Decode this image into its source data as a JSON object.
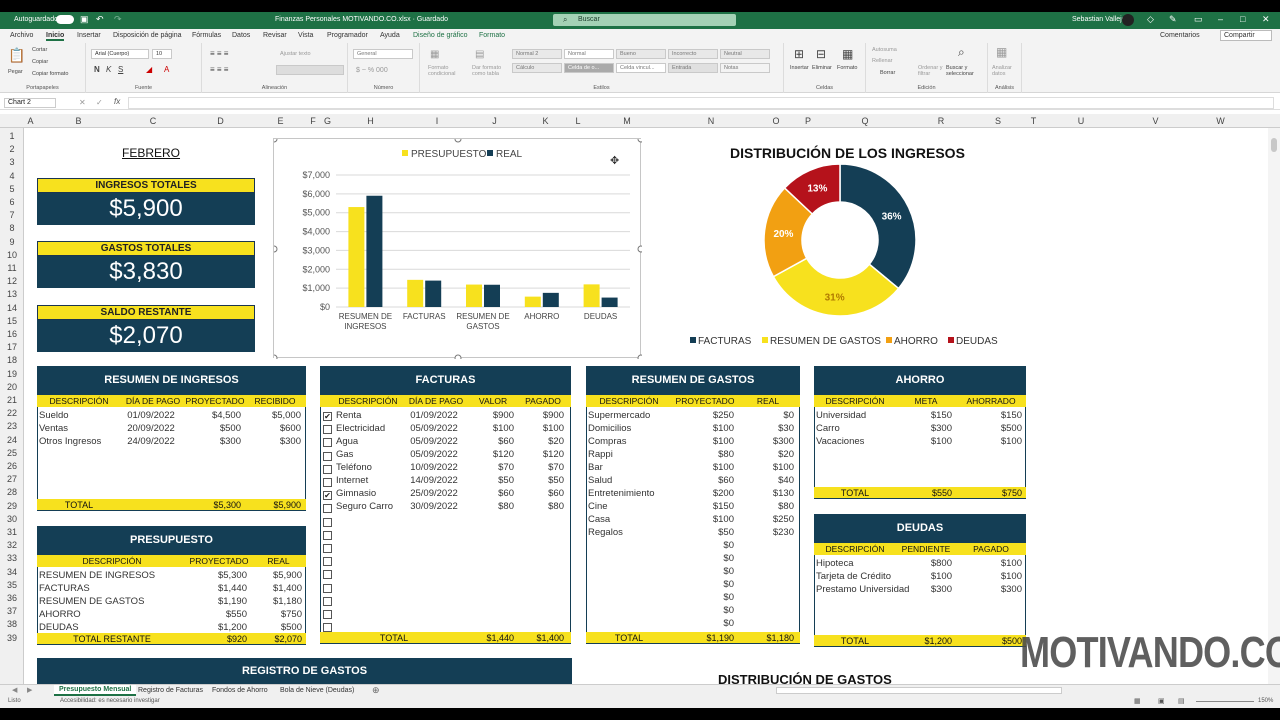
{
  "window": {
    "autosave_label": "Autoguardado",
    "doc_title": "Finanzas Personales MOTIVANDO.CO.xlsx · Guardado",
    "search_placeholder": "Buscar",
    "user_name": "Sebastian Vallejo",
    "accent": "#1e7145"
  },
  "ribbon": {
    "tabs": [
      "Archivo",
      "Inicio",
      "Insertar",
      "Disposición de página",
      "Fórmulas",
      "Datos",
      "Revisar",
      "Vista",
      "Programador",
      "Ayuda",
      "Diseño de gráfico",
      "Formato"
    ],
    "active_tab": "Inicio",
    "comments": "Comentarios",
    "share": "Compartir",
    "clipboard": {
      "paste": "Pegar",
      "cut": "Cortar",
      "copy": "Copiar",
      "format": "Copiar formato",
      "label": "Portapapeles"
    },
    "font": {
      "name": "Arial (Cuerpo)",
      "size": "10",
      "label": "Fuente"
    },
    "alignment": {
      "wrap": "Ajustar texto",
      "label": "Alineación"
    },
    "number": {
      "format": "General",
      "label": "Número"
    },
    "styles": {
      "cond": "Formato condicional",
      "table": "Dar formato como tabla",
      "cells": [
        "Normal 2",
        "Normal",
        "Bueno",
        "Incorrecto",
        "Neutral",
        "Cálculo",
        "Celda de o...",
        "Celda vincul...",
        "Entrada",
        "Notas"
      ],
      "label": "Estilos"
    },
    "cells_grp": {
      "insert": "Insertar",
      "delete": "Eliminar",
      "format": "Formato",
      "label": "Celdas"
    },
    "editing": {
      "autosum": "Autosuma",
      "fill": "Rellenar",
      "clear": "Borrar",
      "sort": "Ordenar y filtrar",
      "find": "Buscar y seleccionar",
      "label": "Edición"
    },
    "analysis": {
      "analyze": "Analizar datos",
      "label": "Análisis"
    }
  },
  "formula_bar": {
    "name_box": "Chart 2",
    "fx": "fx"
  },
  "columns": [
    "A",
    "B",
    "C",
    "D",
    "E",
    "F",
    "G",
    "H",
    "I",
    "J",
    "K",
    "L",
    "M",
    "N",
    "O",
    "P",
    "Q",
    "R",
    "S",
    "T",
    "U",
    "V",
    "W"
  ],
  "rows": [
    "1",
    "2",
    "3",
    "4",
    "5",
    "6",
    "7",
    "8",
    "9",
    "10",
    "11",
    "12",
    "13",
    "14",
    "15",
    "16",
    "17",
    "18",
    "19",
    "20",
    "21",
    "22",
    "23",
    "24",
    "25",
    "26",
    "27",
    "28",
    "29",
    "30",
    "31",
    "32",
    "33",
    "34",
    "35",
    "36",
    "37",
    "38",
    "39"
  ],
  "month": "FEBRERO",
  "kpis": [
    {
      "label": "INGRESOS TOTALES",
      "value": "$5,900"
    },
    {
      "label": "GASTOS TOTALES",
      "value": "$3,830"
    },
    {
      "label": "SALDO RESTANTE",
      "value": "$2,070"
    }
  ],
  "colors": {
    "navy": "#143e55",
    "yellow": "#f7e11e",
    "orange": "#f2a012",
    "red": "#b5121b"
  },
  "chart_data": [
    {
      "type": "bar",
      "categories": [
        "RESUMEN DE INGRESOS",
        "FACTURAS",
        "RESUMEN DE GASTOS",
        "AHORRO",
        "DEUDAS"
      ],
      "series": [
        {
          "name": "PRESUPUESTO",
          "values": [
            5300,
            1440,
            1190,
            550,
            1200
          ],
          "color": "#f7e11e"
        },
        {
          "name": "REAL",
          "values": [
            5900,
            1400,
            1180,
            750,
            500
          ],
          "color": "#143e55"
        }
      ],
      "yticks": [
        "$0",
        "$1,000",
        "$2,000",
        "$3,000",
        "$4,000",
        "$5,000",
        "$6,000",
        "$7,000"
      ],
      "ylim": [
        0,
        7000
      ],
      "grid": true,
      "legend": "top"
    },
    {
      "type": "pie",
      "title": "DISTRIBUCIÓN DE LOS INGRESOS",
      "categories": [
        "FACTURAS",
        "RESUMEN DE GASTOS",
        "AHORRO",
        "DEUDAS"
      ],
      "values": [
        36,
        31,
        20,
        13
      ],
      "labels": [
        "36%",
        "31%",
        "20%",
        "13%"
      ],
      "colors": [
        "#143e55",
        "#f7e11e",
        "#f2a012",
        "#b5121b"
      ],
      "donut": true,
      "legend": "bottom"
    }
  ],
  "ingresos": {
    "title": "RESUMEN DE INGRESOS",
    "headers": [
      "DESCRIPCIÓN",
      "DÍA DE PAGO",
      "PROYECTADO",
      "RECIBIDO"
    ],
    "rows": [
      [
        "Sueldo",
        "01/09/2022",
        "$4,500",
        "$5,000"
      ],
      [
        "Ventas",
        "20/09/2022",
        "$500",
        "$600"
      ],
      [
        "Otros Ingresos",
        "24/09/2022",
        "$300",
        "$300"
      ]
    ],
    "total": [
      "TOTAL",
      "$5,300",
      "$5,900"
    ]
  },
  "facturas": {
    "title": "FACTURAS",
    "headers": [
      "DESCRIPCIÓN",
      "DÍA DE PAGO",
      "VALOR",
      "PAGADO"
    ],
    "rows": [
      {
        "checked": true,
        "cells": [
          "Renta",
          "01/09/2022",
          "$900",
          "$900"
        ]
      },
      {
        "checked": false,
        "cells": [
          "Electricidad",
          "05/09/2022",
          "$100",
          "$100"
        ]
      },
      {
        "checked": false,
        "cells": [
          "Agua",
          "05/09/2022",
          "$60",
          "$20"
        ]
      },
      {
        "checked": false,
        "cells": [
          "Gas",
          "05/09/2022",
          "$120",
          "$120"
        ]
      },
      {
        "checked": false,
        "cells": [
          "Teléfono",
          "10/09/2022",
          "$70",
          "$70"
        ]
      },
      {
        "checked": false,
        "cells": [
          "Internet",
          "14/09/2022",
          "$50",
          "$50"
        ]
      },
      {
        "checked": true,
        "cells": [
          "Gimnasio",
          "25/09/2022",
          "$60",
          "$60"
        ]
      },
      {
        "checked": false,
        "cells": [
          "Seguro Carro",
          "30/09/2022",
          "$80",
          "$80"
        ]
      }
    ],
    "empty_checkboxes": 9,
    "total": [
      "TOTAL",
      "$1,440",
      "$1,400"
    ]
  },
  "gastos": {
    "title": "RESUMEN DE GASTOS",
    "headers": [
      "DESCRIPCIÓN",
      "PROYECTADO",
      "REAL"
    ],
    "rows": [
      [
        "Supermercado",
        "$250",
        "$0"
      ],
      [
        "Domicilios",
        "$100",
        "$30"
      ],
      [
        "Compras",
        "$100",
        "$300"
      ],
      [
        "Rappi",
        "$80",
        "$20"
      ],
      [
        "Bar",
        "$100",
        "$100"
      ],
      [
        "Salud",
        "$60",
        "$40"
      ],
      [
        "Entretenimiento",
        "$200",
        "$130"
      ],
      [
        "Cine",
        "$150",
        "$80"
      ],
      [
        "Casa",
        "$100",
        "$250"
      ],
      [
        "Regalos",
        "$50",
        "$230"
      ],
      [
        "",
        "$0",
        ""
      ],
      [
        "",
        "$0",
        ""
      ],
      [
        "",
        "$0",
        ""
      ],
      [
        "",
        "$0",
        ""
      ],
      [
        "",
        "$0",
        ""
      ],
      [
        "",
        "$0",
        ""
      ],
      [
        "",
        "$0",
        ""
      ]
    ],
    "total": [
      "TOTAL",
      "$1,190",
      "$1,180"
    ]
  },
  "ahorro": {
    "title": "AHORRO",
    "headers": [
      "DESCRIPCIÓN",
      "META",
      "AHORRADO"
    ],
    "rows": [
      [
        "Universidad",
        "$150",
        "$150"
      ],
      [
        "Carro",
        "$300",
        "$500"
      ],
      [
        "Vacaciones",
        "$100",
        "$100"
      ]
    ],
    "total": [
      "TOTAL",
      "$550",
      "$750"
    ]
  },
  "deudas": {
    "title": "DEUDAS",
    "headers": [
      "DESCRIPCIÓN",
      "PENDIENTE",
      "PAGADO"
    ],
    "rows": [
      [
        "Hipoteca",
        "$800",
        "$100"
      ],
      [
        "Tarjeta de Crédito",
        "$100",
        "$100"
      ],
      [
        "Prestamo Universidad",
        "$300",
        "$300"
      ]
    ],
    "total": [
      "TOTAL",
      "$1,200",
      "$500"
    ]
  },
  "presupuesto": {
    "title": "PRESUPUESTO",
    "headers": [
      "DESCRIPCIÓN",
      "PROYECTADO",
      "REAL"
    ],
    "rows": [
      [
        "RESUMEN DE INGRESOS",
        "$5,300",
        "$5,900"
      ],
      [
        "FACTURAS",
        "$1,440",
        "$1,400"
      ],
      [
        "RESUMEN DE GASTOS",
        "$1,190",
        "$1,180"
      ],
      [
        "AHORRO",
        "$550",
        "$750"
      ],
      [
        "DEUDAS",
        "$1,200",
        "$500"
      ]
    ],
    "total": [
      "TOTAL RESTANTE",
      "$920",
      "$2,070"
    ]
  },
  "registro_title": "REGISTRO DE GASTOS",
  "dist_gastos_title": "DISTRIBUCIÓN DE GASTOS",
  "watermark": "MOTIVANDO.CO",
  "sheet_tabs": [
    "Presupuesto Mensual",
    "Registro de Facturas",
    "Fondos de Ahorro",
    "Bola de Nieve (Deudas)"
  ],
  "active_sheet": "Presupuesto Mensual",
  "status": {
    "ready": "Listo",
    "accessibility": "Accesibilidad: es necesario investigar",
    "zoom": "150%"
  }
}
